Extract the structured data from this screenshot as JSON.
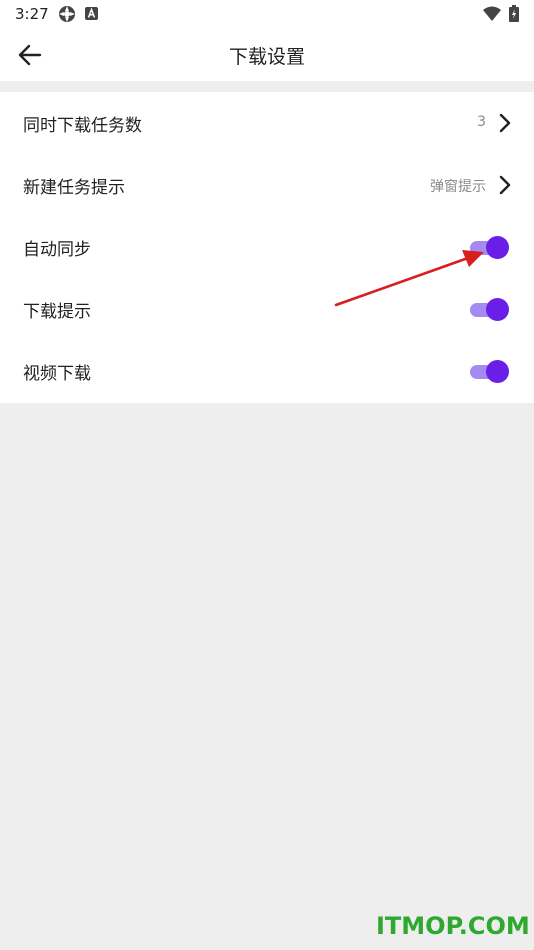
{
  "status_bar": {
    "time": "3:27",
    "icons": [
      "gear-icon",
      "a-letter-icon",
      "wifi-icon",
      "battery-charging-icon"
    ]
  },
  "app_bar": {
    "title": "下载设置",
    "back_icon": "arrow-left-icon"
  },
  "settings": [
    {
      "label": "同时下载任务数",
      "value": "3",
      "control": "chevron"
    },
    {
      "label": "新建任务提示",
      "value": "弹窗提示",
      "control": "chevron"
    },
    {
      "label": "自动同步",
      "control": "toggle",
      "on": true
    },
    {
      "label": "下载提示",
      "control": "toggle",
      "on": true
    },
    {
      "label": "视频下载",
      "control": "toggle",
      "on": true
    }
  ],
  "colors": {
    "accent": "#6a1fe8",
    "toggle_track": "#a58af0",
    "annotation_arrow": "#d81f1f",
    "watermark": "#2ea82e"
  },
  "watermark": "ITMOP.COM"
}
